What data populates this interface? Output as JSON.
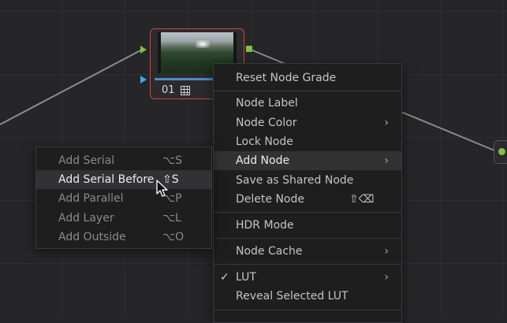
{
  "node": {
    "label": "01"
  },
  "context_menu": {
    "items": [
      {
        "label": "Reset Node Grade"
      },
      {
        "label": "Node Label"
      },
      {
        "label": "Node Color",
        "arrow": "›"
      },
      {
        "label": "Lock Node"
      },
      {
        "label": "Add Node",
        "arrow": "›"
      },
      {
        "label": "Save as Shared Node"
      },
      {
        "label": "Delete Node",
        "shortcut": "⇧⌫"
      },
      {
        "label": "HDR Mode"
      },
      {
        "label": "Node Cache",
        "arrow": "›"
      },
      {
        "label": "LUT",
        "arrow": "›",
        "check": "✓"
      },
      {
        "label": "Reveal Selected LUT"
      }
    ]
  },
  "add_node_submenu": {
    "items": [
      {
        "label": "Add Serial",
        "shortcut": "⌥S"
      },
      {
        "label": "Add Serial Before",
        "shortcut": "⇧S"
      },
      {
        "label": "Add Parallel",
        "shortcut": "⌥P"
      },
      {
        "label": "Add Layer",
        "shortcut": "⌥L"
      },
      {
        "label": "Add Outside",
        "shortcut": "⌥O"
      }
    ]
  },
  "colors": {
    "background": "#262628",
    "node_border_selected": "#c04a44",
    "port_green": "#7ec04a",
    "port_blue": "#3fa7e6",
    "menu_bg": "#1e1e1f",
    "menu_highlight": "#323234"
  }
}
